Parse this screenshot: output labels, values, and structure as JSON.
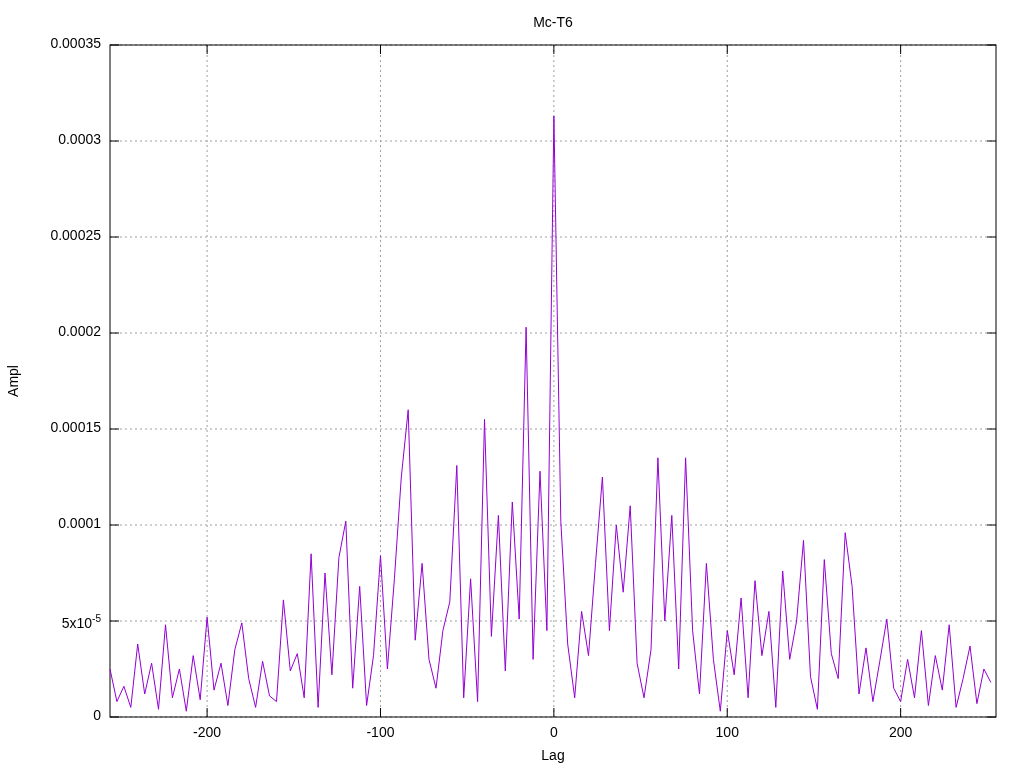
{
  "chart_data": {
    "type": "line",
    "title": "Mc-T6",
    "xlabel": "Lag",
    "ylabel": "Ampl",
    "grid": true,
    "xlim": [
      -256,
      255
    ],
    "ylim": [
      0,
      0.00035
    ],
    "xticks": [
      -200,
      -100,
      0,
      100,
      200
    ],
    "yticks": [
      {
        "value": 0,
        "label": "0"
      },
      {
        "value": 5e-05,
        "label": "5x10$^{-5}$"
      },
      {
        "value": 0.0001,
        "label": "0.0001"
      },
      {
        "value": 0.00015,
        "label": "0.00015"
      },
      {
        "value": 0.0002,
        "label": "0.0002"
      },
      {
        "value": 0.00025,
        "label": "0.00025"
      },
      {
        "value": 0.0003,
        "label": "0.0003"
      },
      {
        "value": 0.00035,
        "label": "0.00035"
      }
    ],
    "x": [
      -256,
      -252,
      -248,
      -244,
      -240,
      -236,
      -232,
      -228,
      -224,
      -220,
      -216,
      -212,
      -208,
      -204,
      -200,
      -196,
      -192,
      -188,
      -184,
      -180,
      -176,
      -172,
      -168,
      -164,
      -160,
      -156,
      -152,
      -148,
      -144,
      -140,
      -136,
      -132,
      -128,
      -124,
      -120,
      -116,
      -112,
      -108,
      -104,
      -100,
      -96,
      -92,
      -88,
      -84,
      -80,
      -76,
      -72,
      -68,
      -64,
      -60,
      -56,
      -52,
      -48,
      -44,
      -40,
      -36,
      -32,
      -28,
      -24,
      -20,
      -16,
      -12,
      -8,
      -4,
      0,
      4,
      8,
      12,
      16,
      20,
      24,
      28,
      32,
      36,
      40,
      44,
      48,
      52,
      56,
      60,
      64,
      68,
      72,
      76,
      80,
      84,
      88,
      92,
      96,
      100,
      104,
      108,
      112,
      116,
      120,
      124,
      128,
      132,
      136,
      140,
      144,
      148,
      152,
      156,
      160,
      164,
      168,
      172,
      176,
      180,
      184,
      188,
      192,
      196,
      200,
      204,
      208,
      212,
      216,
      220,
      224,
      228,
      232,
      236,
      240,
      244,
      248,
      252
    ],
    "series": [
      {
        "color": "#9400d3",
        "values": [
          2.5e-05,
          8e-06,
          1.6e-05,
          5e-06,
          3.8e-05,
          1.2e-05,
          2.8e-05,
          4e-06,
          4.8e-05,
          1e-05,
          2.5e-05,
          3e-06,
          3.2e-05,
          9e-06,
          5.2e-05,
          1.4e-05,
          2.8e-05,
          6e-06,
          3.5e-05,
          4.9e-05,
          2e-05,
          5e-06,
          2.9e-05,
          1.1e-05,
          8e-06,
          6.1e-05,
          2.4e-05,
          3.3e-05,
          1e-05,
          8.5e-05,
          5e-06,
          7.5e-05,
          2.2e-05,
          8.3e-05,
          0.000102,
          1.5e-05,
          6.8e-05,
          6e-06,
          3.2e-05,
          8.4e-05,
          2.5e-05,
          7.2e-05,
          0.000125,
          0.00016,
          4e-05,
          8e-05,
          3e-05,
          1.5e-05,
          4.5e-05,
          6e-05,
          0.000131,
          1e-05,
          7.2e-05,
          8e-06,
          0.000155,
          4.2e-05,
          0.000105,
          2.4e-05,
          0.000112,
          5.1e-05,
          0.000203,
          3e-05,
          0.000128,
          4.5e-05,
          0.000313,
          0.000102,
          3.8e-05,
          1e-05,
          5.5e-05,
          3.2e-05,
          8e-05,
          0.000125,
          4.5e-05,
          0.0001,
          6.5e-05,
          0.00011,
          2.8e-05,
          1e-05,
          3.5e-05,
          0.000135,
          5e-05,
          0.000105,
          2.5e-05,
          0.000135,
          4.5e-05,
          1.2e-05,
          8e-05,
          3e-05,
          3e-06,
          4.5e-05,
          2.2e-05,
          6.2e-05,
          1e-05,
          7.1e-05,
          3.2e-05,
          5.5e-05,
          5e-06,
          7.6e-05,
          3e-05,
          5e-05,
          9.2e-05,
          2.1e-05,
          4e-06,
          8.2e-05,
          3.3e-05,
          2e-05,
          9.6e-05,
          6.8e-05,
          1.2e-05,
          3.6e-05,
          8e-06,
          2.9e-05,
          5.1e-05,
          1.5e-05,
          8e-06,
          3e-05,
          1e-05,
          4.5e-05,
          6e-06,
          3.2e-05,
          1.4e-05,
          4.8e-05,
          5e-06,
          2e-05,
          3.7e-05,
          7e-06,
          2.5e-05,
          1.8e-05
        ]
      }
    ]
  }
}
